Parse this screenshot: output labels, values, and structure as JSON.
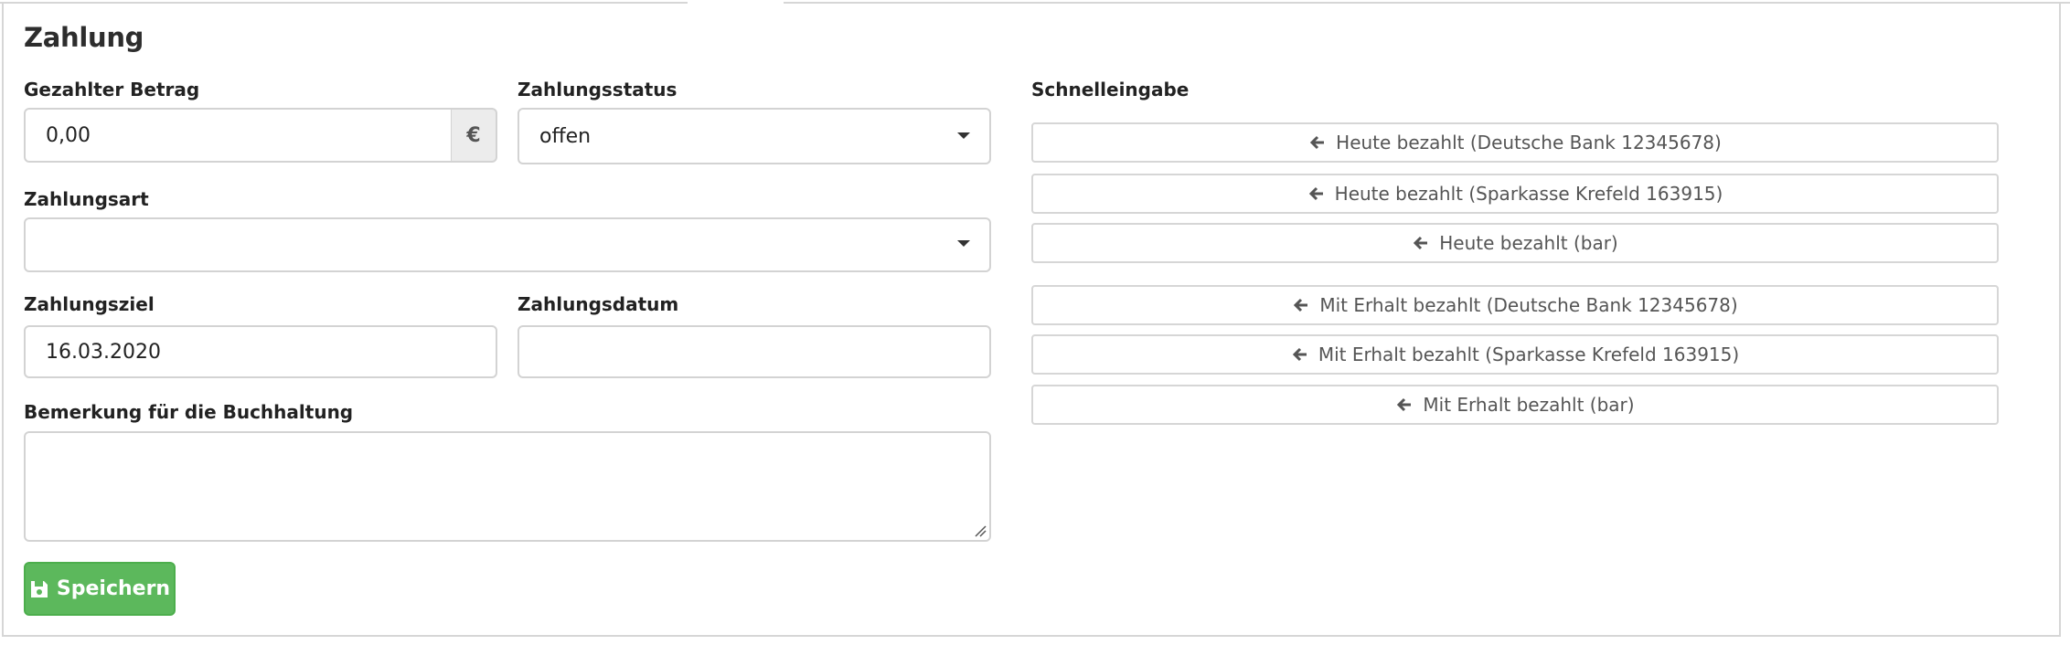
{
  "section_title": "Zahlung",
  "fields": {
    "amount": {
      "label": "Gezahlter Betrag",
      "value": "0,00",
      "currency": "€"
    },
    "status": {
      "label": "Zahlungsstatus",
      "value": "offen"
    },
    "method": {
      "label": "Zahlungsart",
      "value": ""
    },
    "due_date": {
      "label": "Zahlungsziel",
      "value": "16.03.2020"
    },
    "payment_date": {
      "label": "Zahlungsdatum",
      "value": ""
    },
    "note": {
      "label": "Bemerkung für die Buchhaltung",
      "value": ""
    }
  },
  "quick_entry": {
    "label": "Schnelleingabe",
    "buttons": [
      "Heute bezahlt (Deutsche Bank 12345678)",
      "Heute bezahlt (Sparkasse Krefeld 163915)",
      "Heute bezahlt (bar)",
      "Mit Erhalt bezahlt (Deutsche Bank 12345678)",
      "Mit Erhalt bezahlt (Sparkasse Krefeld 163915)",
      "Mit Erhalt bezahlt (bar)"
    ]
  },
  "save_button": {
    "label": "Speichern",
    "color": "#5cb85c",
    "icon": "save-icon"
  },
  "icons": {
    "quick_button_icon": "arrow-left-icon",
    "select_icon": "caret-down-icon"
  }
}
